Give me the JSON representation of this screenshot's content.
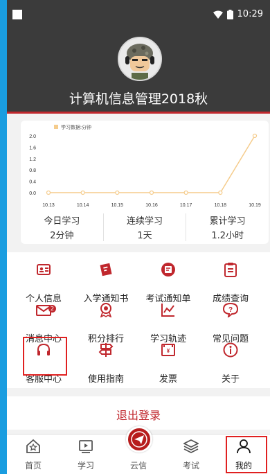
{
  "status_bar": {
    "time": "10:29"
  },
  "profile": {
    "course_title": "计算机信息管理2018秋"
  },
  "chart_data": {
    "type": "line",
    "legend": "学习数据:分钟",
    "x": [
      "10.13",
      "10.14",
      "10.15",
      "10.16",
      "10.17",
      "10.18",
      "10.19"
    ],
    "values": [
      0,
      0,
      0,
      0,
      0,
      0,
      2
    ],
    "y_ticks": [
      "2.0",
      "1.6",
      "1.2",
      "0.8",
      "0.4",
      "0.0"
    ],
    "ylim": [
      0,
      2
    ],
    "color": "#f5cc8c"
  },
  "stats": [
    {
      "label": "今日学习",
      "value": "2分钟"
    },
    {
      "label": "连续学习",
      "value": "1天"
    },
    {
      "label": "累计学习",
      "value": "1.2小时"
    }
  ],
  "menu": [
    {
      "label": "个人信息",
      "icon": "id-card-icon"
    },
    {
      "label": "入学通知书",
      "icon": "notice-letter-icon"
    },
    {
      "label": "考试通知单",
      "icon": "exam-notice-icon"
    },
    {
      "label": "成绩查询",
      "icon": "clipboard-icon"
    },
    {
      "label": "消息中心",
      "icon": "mail-icon",
      "badge": "2"
    },
    {
      "label": "积分排行",
      "icon": "medal-icon"
    },
    {
      "label": "学习轨迹",
      "icon": "trend-chart-icon"
    },
    {
      "label": "常见问题",
      "icon": "question-bubble-icon"
    },
    {
      "label": "客服中心",
      "icon": "headset-icon"
    },
    {
      "label": "使用指南",
      "icon": "signpost-icon"
    },
    {
      "label": "发票",
      "icon": "invoice-icon"
    },
    {
      "label": "关于",
      "icon": "info-icon"
    }
  ],
  "logout": {
    "label": "退出登录"
  },
  "tabs": [
    {
      "label": "首页",
      "icon": "home-icon"
    },
    {
      "label": "学习",
      "icon": "video-icon"
    },
    {
      "label": "云信",
      "icon": "paper-plane-icon"
    },
    {
      "label": "考试",
      "icon": "layers-icon"
    },
    {
      "label": "我的",
      "icon": "user-icon",
      "active": true
    }
  ],
  "colors": {
    "accent": "#c0272d",
    "header_bg": "#3b3b3b",
    "highlight_box": "#e02020"
  }
}
